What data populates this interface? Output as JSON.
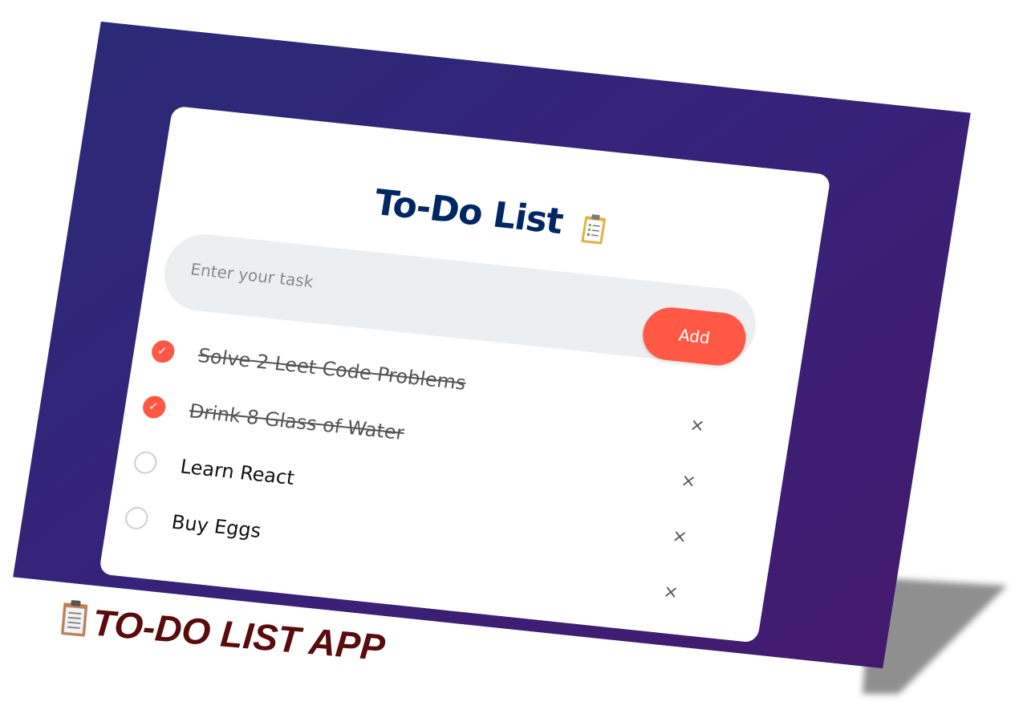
{
  "app": {
    "title": "To-Do List",
    "title_icon": "clipboard-icon"
  },
  "input": {
    "placeholder": "Enter your task",
    "value": ""
  },
  "add_button": {
    "label": "Add"
  },
  "tasks": [
    {
      "text": "Solve 2 Leet Code Problems",
      "done": true
    },
    {
      "text": "Drink 8 Glass of Water",
      "done": true
    },
    {
      "text": "Learn React",
      "done": false
    },
    {
      "text": "Buy Eggs",
      "done": false
    }
  ],
  "delete_glyph": "×",
  "caption": {
    "icon": "clipboard-icon",
    "text": "TO-DO LIST APP"
  },
  "colors": {
    "accent": "#ff5945",
    "title": "#002765",
    "background_start": "#2b2a77",
    "background_end": "#441a6e",
    "caption": "#5a0b0b"
  }
}
